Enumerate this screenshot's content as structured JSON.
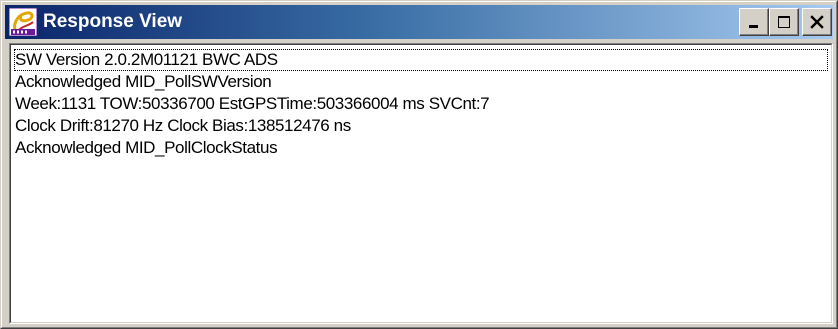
{
  "window": {
    "title": "Response View",
    "icon": "sirf-app-icon",
    "buttons": {
      "minimize": "minimize-icon",
      "maximize": "maximize-icon",
      "close": "close-icon"
    }
  },
  "colors": {
    "titlebar_start": "#0a246a",
    "titlebar_end": "#a6caf0",
    "frame": "#d4d0c8"
  },
  "response_lines": [
    "SW Version 2.0.2M01121 BWC ADS",
    "Acknowledged MID_PollSWVersion",
    "Week:1131  TOW:50336700  EstGPSTime:503366004 ms  SVCnt:7",
    "Clock Drift:81270 Hz  Clock Bias:138512476 ns",
    "Acknowledged MID_PollClockStatus"
  ]
}
